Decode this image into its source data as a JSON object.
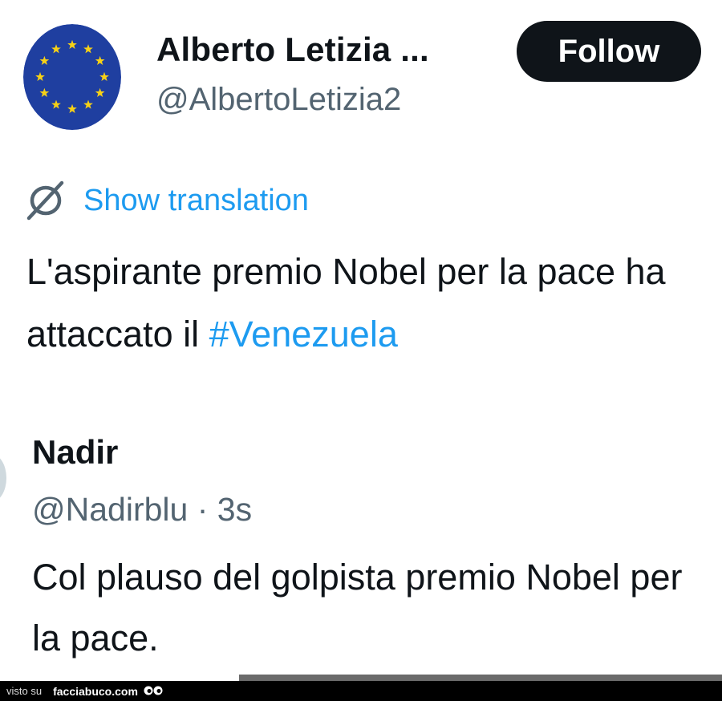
{
  "author": {
    "name": "Alberto Letizia ...",
    "handle": "@AlbertoLetizia2",
    "avatar_icon": "eu-flag-icon",
    "avatar_colors": {
      "background": "#1f3fa0",
      "stars": "#f7d116"
    }
  },
  "follow_button": {
    "label": "Follow"
  },
  "translation": {
    "label": "Show translation",
    "icon": "translate-icon"
  },
  "tweet": {
    "text_before_hashtag": "L'aspirante premio Nobel per la pace ha attaccato il ",
    "hashtag": "#Venezuela"
  },
  "reply": {
    "name": "Nadir",
    "handle": "@Nadirblu",
    "separator": "·",
    "time": "3s",
    "text": "Col plauso del golpista premio Nobel per la pace."
  },
  "watermark": {
    "prefix": "visto su",
    "brand": "facciabuco.com"
  },
  "colors": {
    "link": "#1d9bf0",
    "text": "#0f1419",
    "secondary_text": "#536471",
    "button_background": "#0f1419"
  }
}
